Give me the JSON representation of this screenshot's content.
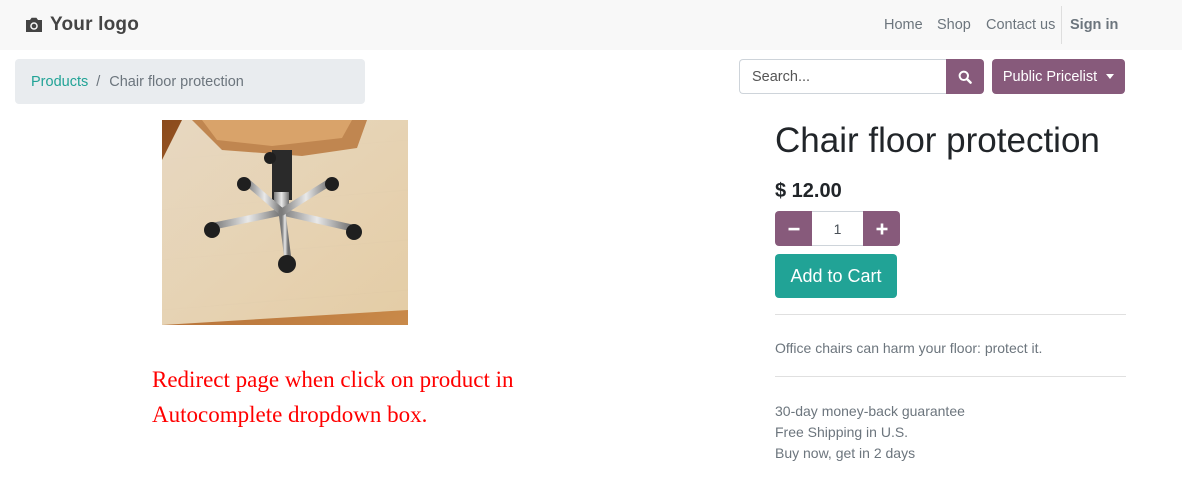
{
  "header": {
    "logo_text": "Your logo",
    "nav": {
      "home": "Home",
      "shop": "Shop",
      "contact": "Contact us",
      "sign_in": "Sign in"
    }
  },
  "breadcrumb": {
    "parent": "Products",
    "separator": "/",
    "current": "Chair floor protection"
  },
  "search": {
    "placeholder": "Search...",
    "value": "",
    "button_icon": "search-icon"
  },
  "pricelist": {
    "label": "Public Pricelist"
  },
  "product": {
    "name": "Chair floor protection",
    "price": "$ 12.00",
    "quantity": "1",
    "add_to_cart": "Add to Cart",
    "description": "Office chairs can harm your floor: protect it.",
    "features": [
      "30-day money-back guarantee",
      "Free Shipping in U.S.",
      "Buy now, get in 2 days"
    ]
  },
  "annotation": {
    "line1": "Redirect page when click on product in",
    "line2": "Autocomplete dropdown box."
  },
  "colors": {
    "primary": "#875a7b",
    "accent": "#21a396",
    "annotation": "#ff0000"
  }
}
